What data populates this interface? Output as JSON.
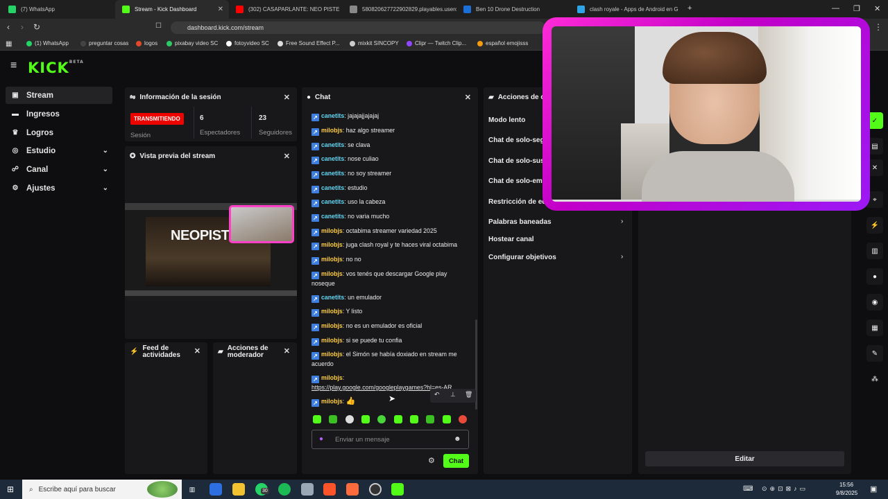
{
  "browser": {
    "tabs": [
      {
        "label": "(7) WhatsApp",
        "color": "#25d366"
      },
      {
        "label": "Stream - Kick Dashboard",
        "color": "#53fc18"
      },
      {
        "label": "(302) CASAPARLANTE: NEO PISTE",
        "color": "#ff0000"
      },
      {
        "label": "580820627722902829.playables.usercontent",
        "color": "#888888"
      },
      {
        "label": "Ben 10 Drone Destruction",
        "color": "#1d6fd8"
      },
      {
        "label": "clash royale - Apps de Android en G",
        "color": "#2fa4e7"
      }
    ],
    "url": "dashboard.kick.com/stream",
    "bookmarks": [
      "(1) WhatsApp",
      "preguntar cosas",
      "logos",
      "pixabay video SC",
      "fotoyvideo SC",
      "Free Sound Effect P...",
      "mixkit SINCOPY",
      "Clipr — Twitch Clip...",
      "español emojisss"
    ]
  },
  "kick": {
    "logo": "KICK",
    "logo_tag": "BETA",
    "sidebar": [
      {
        "label": "Stream",
        "icon": "video-icon"
      },
      {
        "label": "Ingresos",
        "icon": "money-icon"
      },
      {
        "label": "Logros",
        "icon": "trophy-icon"
      },
      {
        "label": "Estudio",
        "icon": "studio-icon"
      },
      {
        "label": "Canal",
        "icon": "channel-icon"
      },
      {
        "label": "Ajustes",
        "icon": "gear-icon"
      }
    ],
    "session": {
      "title": "Información de la sesión",
      "badge": "TRANSMITIENDO",
      "badge_label": "Sesión",
      "viewers": "6",
      "viewers_label": "Espectadores",
      "followers": "23",
      "followers_label": "Seguidores"
    },
    "preview": {
      "title": "Vista previa del stream",
      "overlay_text": "NEOPISTE"
    },
    "feed": {
      "title": "Feed de actividades"
    },
    "modpanel": {
      "title": "Acciones de moderador"
    },
    "chat": {
      "title": "Chat",
      "messages": [
        {
          "user": "canetits",
          "text": "jajajajjajajaj",
          "cls": "c"
        },
        {
          "user": "milobjs",
          "text": "haz algo streamer",
          "cls": "m"
        },
        {
          "user": "canetits",
          "text": "se clava",
          "cls": "c"
        },
        {
          "user": "canetits",
          "text": "nose culiao",
          "cls": "c"
        },
        {
          "user": "canetits",
          "text": "no soy streamer",
          "cls": "c"
        },
        {
          "user": "canetits",
          "text": "estudio",
          "cls": "c"
        },
        {
          "user": "canetits",
          "text": "uso la cabeza",
          "cls": "c"
        },
        {
          "user": "canetits",
          "text": "no varia mucho",
          "cls": "c"
        },
        {
          "user": "milobjs",
          "text": "octabima streamer variedad 2025",
          "cls": "m"
        },
        {
          "user": "milobjs",
          "text": "juga clash royal y te haces viral octabima",
          "cls": "m"
        },
        {
          "user": "milobjs",
          "text": "no no",
          "cls": "m"
        },
        {
          "user": "milobjs",
          "text": "vos tenés que descargar Google play noseque",
          "cls": "m"
        },
        {
          "user": "canetits",
          "text": "un emulador",
          "cls": "c"
        },
        {
          "user": "milobjs",
          "text": "Y listo",
          "cls": "m"
        },
        {
          "user": "milobjs",
          "text": "no es un emulador es oficial",
          "cls": "m"
        },
        {
          "user": "milobjs",
          "text": "si se puede tu confia",
          "cls": "m"
        },
        {
          "user": "milobjs",
          "text": "el Simón se había doxiado en stream me acuerdo",
          "cls": "m"
        },
        {
          "user": "milobjs",
          "text": "",
          "cls": "m"
        },
        {
          "user": "milobjs",
          "text": "",
          "cls": "m"
        }
      ],
      "link": "https://play.google.com/googleplaygames?hl=es-AR",
      "input_placeholder": "Enviar un mensaje",
      "send_label": "Chat"
    },
    "modactions": {
      "title": "Acciones de c",
      "items": [
        "Modo lento",
        "Chat de solo-seg",
        "Chat de solo-sus",
        "Chat de solo-em",
        "Restricción de ed",
        "Palabras baneadas",
        "Hostear canal",
        "Configurar objetivos"
      ]
    },
    "edit_label": "Editar"
  },
  "taskbar": {
    "search_placeholder": "Escribe aquí para buscar",
    "time": "15:56",
    "date": "9/8/2025",
    "badge_count": "30"
  }
}
